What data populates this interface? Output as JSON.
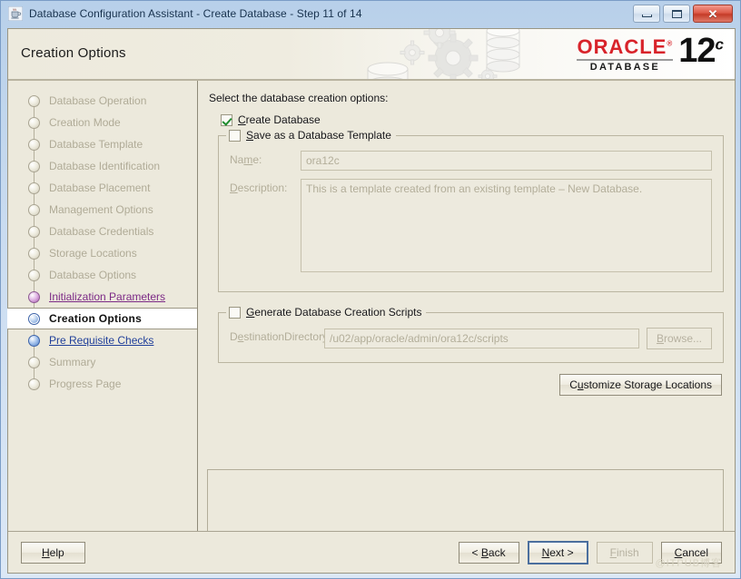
{
  "window": {
    "title": "Database Configuration Assistant - Create Database - Step 11 of 14",
    "app_icon": "java-coffee-cup-icon",
    "controls": {
      "minimize": "minimize-icon",
      "maximize": "maximize-icon",
      "close": "✕"
    }
  },
  "header": {
    "page_title": "Creation Options",
    "brand": {
      "name": "ORACLE",
      "registered": "®",
      "product": "DATABASE",
      "version_number": "12",
      "version_suffix": "c"
    }
  },
  "sidebar": {
    "steps": [
      {
        "label": "Database Operation",
        "state": "done"
      },
      {
        "label": "Creation Mode",
        "state": "done"
      },
      {
        "label": "Database Template",
        "state": "done"
      },
      {
        "label": "Database Identification",
        "state": "done"
      },
      {
        "label": "Database Placement",
        "state": "done"
      },
      {
        "label": "Management Options",
        "state": "done"
      },
      {
        "label": "Database Credentials",
        "state": "done"
      },
      {
        "label": "Storage Locations",
        "state": "done"
      },
      {
        "label": "Database Options",
        "state": "done"
      },
      {
        "label": "Initialization Parameters",
        "state": "visited"
      },
      {
        "label": "Creation Options",
        "state": "current"
      },
      {
        "label": "Pre Requisite Checks",
        "state": "available"
      },
      {
        "label": "Summary",
        "state": "pending"
      },
      {
        "label": "Progress Page",
        "state": "pending"
      }
    ]
  },
  "content": {
    "instruction": "Select the database creation options:",
    "create_database": {
      "label_mnemonic": "C",
      "label_rest": "reate Database",
      "checked": true
    },
    "save_template_group": {
      "legend_mnemonic": "S",
      "legend_rest": "ave as a Database Template",
      "checked": false,
      "name_label_a": "Na",
      "name_label_mnemonic": "m",
      "name_label_b": "e:",
      "name_value": "ora12c",
      "description_label_mnemonic": "D",
      "description_label_rest": "escription:",
      "description_value": "This is a template created from an existing template – New Database."
    },
    "scripts_group": {
      "legend_mnemonic": "G",
      "legend_rest": "enerate Database Creation Scripts",
      "checked": false,
      "destination_label_a": "D",
      "destination_label_mnemonic": "e",
      "destination_label_b": "stinationDirectory:",
      "destination_value": "/u02/app/oracle/admin/ora12c/scripts",
      "browse_mnemonic": "B",
      "browse_a": "",
      "browse_rest": "rowse..."
    },
    "customize_button": {
      "a": "C",
      "mnemonic": "u",
      "rest": "stomize Storage Locations"
    },
    "message_panel_text": ""
  },
  "footer": {
    "help": {
      "mnemonic": "H",
      "rest": "elp"
    },
    "back": {
      "pre": "< ",
      "mnemonic": "B",
      "rest": "ack"
    },
    "next": {
      "mnemonic": "N",
      "rest": "ext >"
    },
    "finish": {
      "mnemonic": "F",
      "rest": "inish",
      "disabled": true
    },
    "cancel": {
      "mnemonic": "C",
      "rest": "ancel"
    },
    "watermark": "@ITPUB博客"
  },
  "colors": {
    "accent_red": "#d8232a",
    "panel_bg": "#ece9dc",
    "visited_link": "#7c2a86",
    "active_link": "#21409a",
    "check_green": "#1f8c2e"
  }
}
